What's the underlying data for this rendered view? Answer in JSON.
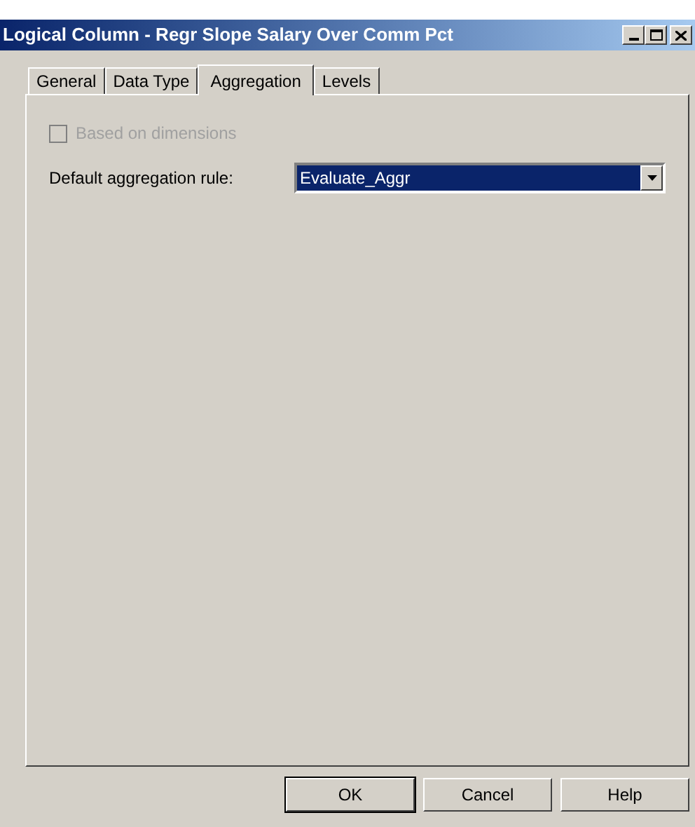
{
  "window": {
    "title": "Logical Column - Regr Slope Salary Over Comm Pct"
  },
  "tabs": [
    {
      "label": "General",
      "selected": false
    },
    {
      "label": "Data Type",
      "selected": false
    },
    {
      "label": "Aggregation",
      "selected": true
    },
    {
      "label": "Levels",
      "selected": false
    }
  ],
  "based_on_dimensions": {
    "label": "Based on dimensions",
    "checked": false,
    "disabled": true
  },
  "aggregation_rule": {
    "label": "Default aggregation rule:",
    "value": "Evaluate_Aggr"
  },
  "buttons": [
    {
      "label": "OK",
      "default": true
    },
    {
      "label": "Cancel",
      "default": false
    },
    {
      "label": "Help",
      "default": false
    }
  ]
}
